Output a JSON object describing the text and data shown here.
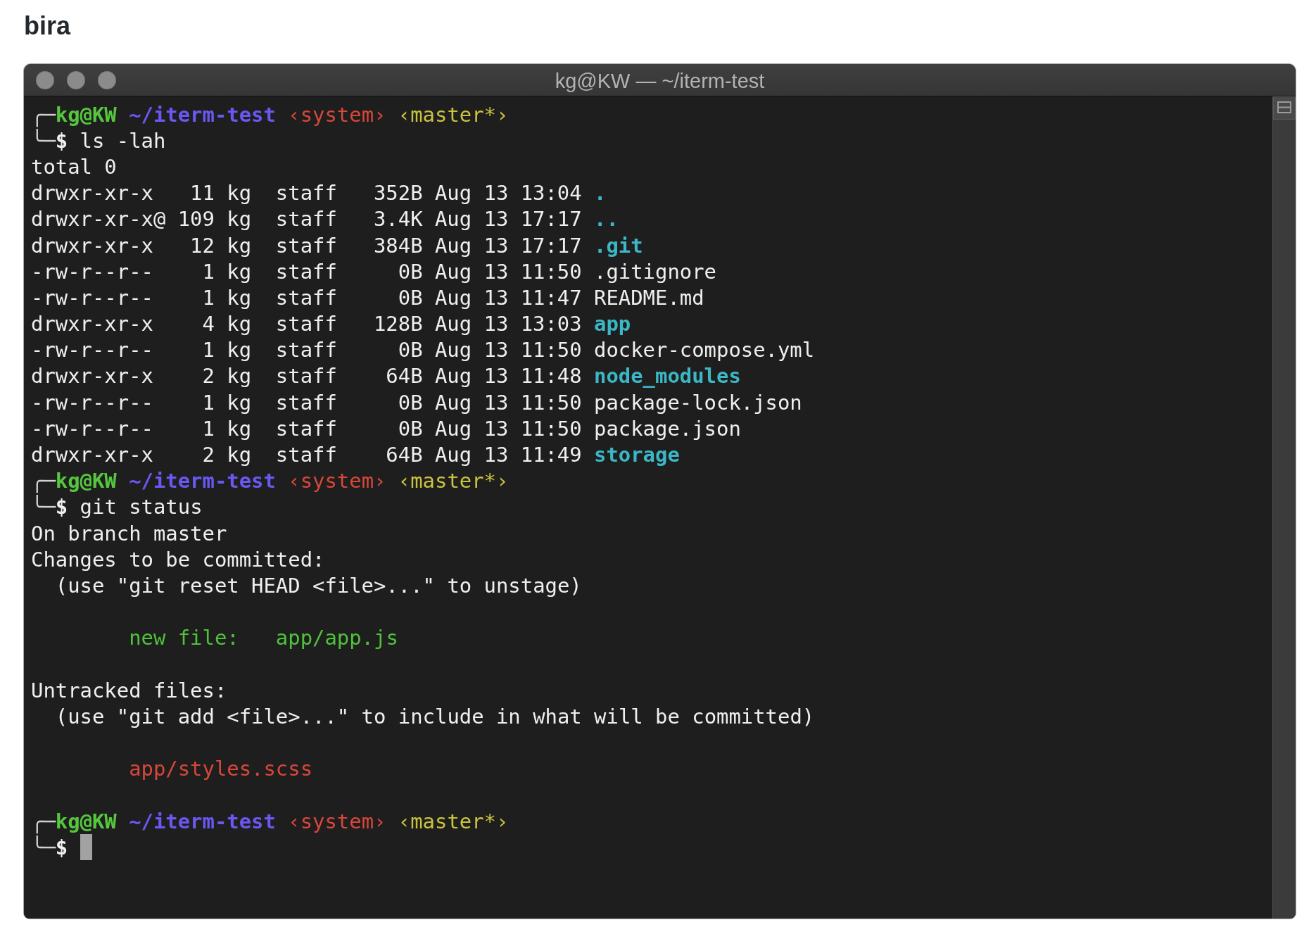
{
  "heading": "bira",
  "window": {
    "title": "kg@KW — ~/iterm-test"
  },
  "terminal": {
    "lines": [
      {
        "kind": "prompt",
        "corner": "╭─",
        "user_host": "kg@KW",
        "directory": "~/iterm-test",
        "ruby": "‹system›",
        "branch": "‹master*›"
      },
      {
        "kind": "command",
        "corner": "╰─",
        "symbol": "$",
        "command": "ls -lah",
        "cursor": false
      },
      {
        "kind": "output",
        "text": "total 0"
      },
      {
        "kind": "listing",
        "permissions": "drwxr-xr-x",
        "links": "11",
        "owner": "kg",
        "group": "staff",
        "size": "352B",
        "modified": "Aug 13 13:04",
        "name": ".",
        "directory": true
      },
      {
        "kind": "listing",
        "permissions": "drwxr-xr-x@",
        "links": "109",
        "owner": "kg",
        "group": "staff",
        "size": "3.4K",
        "modified": "Aug 13 17:17",
        "name": "..",
        "directory": true
      },
      {
        "kind": "listing",
        "permissions": "drwxr-xr-x",
        "links": "12",
        "owner": "kg",
        "group": "staff",
        "size": "384B",
        "modified": "Aug 13 17:17",
        "name": ".git",
        "directory": true
      },
      {
        "kind": "listing",
        "permissions": "-rw-r--r--",
        "links": "1",
        "owner": "kg",
        "group": "staff",
        "size": "0B",
        "modified": "Aug 13 11:50",
        "name": ".gitignore",
        "directory": false
      },
      {
        "kind": "listing",
        "permissions": "-rw-r--r--",
        "links": "1",
        "owner": "kg",
        "group": "staff",
        "size": "0B",
        "modified": "Aug 13 11:47",
        "name": "README.md",
        "directory": false
      },
      {
        "kind": "listing",
        "permissions": "drwxr-xr-x",
        "links": "4",
        "owner": "kg",
        "group": "staff",
        "size": "128B",
        "modified": "Aug 13 13:03",
        "name": "app",
        "directory": true
      },
      {
        "kind": "listing",
        "permissions": "-rw-r--r--",
        "links": "1",
        "owner": "kg",
        "group": "staff",
        "size": "0B",
        "modified": "Aug 13 11:50",
        "name": "docker-compose.yml",
        "directory": false
      },
      {
        "kind": "listing",
        "permissions": "drwxr-xr-x",
        "links": "2",
        "owner": "kg",
        "group": "staff",
        "size": "64B",
        "modified": "Aug 13 11:48",
        "name": "node_modules",
        "directory": true
      },
      {
        "kind": "listing",
        "permissions": "-rw-r--r--",
        "links": "1",
        "owner": "kg",
        "group": "staff",
        "size": "0B",
        "modified": "Aug 13 11:50",
        "name": "package-lock.json",
        "directory": false
      },
      {
        "kind": "listing",
        "permissions": "-rw-r--r--",
        "links": "1",
        "owner": "kg",
        "group": "staff",
        "size": "0B",
        "modified": "Aug 13 11:50",
        "name": "package.json",
        "directory": false
      },
      {
        "kind": "listing",
        "permissions": "drwxr-xr-x",
        "links": "2",
        "owner": "kg",
        "group": "staff",
        "size": "64B",
        "modified": "Aug 13 11:49",
        "name": "storage",
        "directory": true
      },
      {
        "kind": "prompt",
        "corner": "╭─",
        "user_host": "kg@KW",
        "directory": "~/iterm-test",
        "ruby": "‹system›",
        "branch": "‹master*›"
      },
      {
        "kind": "command",
        "corner": "╰─",
        "symbol": "$",
        "command": "git status",
        "cursor": false
      },
      {
        "kind": "output",
        "text": "On branch master"
      },
      {
        "kind": "output",
        "text": "Changes to be committed:"
      },
      {
        "kind": "hint",
        "text": "(use \"git reset HEAD <file>...\" to unstage)"
      },
      {
        "kind": "blank"
      },
      {
        "kind": "staged",
        "text": "new file:   app/app.js"
      },
      {
        "kind": "blank"
      },
      {
        "kind": "output",
        "text": "Untracked files:"
      },
      {
        "kind": "hint",
        "text": "(use \"git add <file>...\" to include in what will be committed)"
      },
      {
        "kind": "blank"
      },
      {
        "kind": "untracked",
        "text": "app/styles.scss"
      },
      {
        "kind": "blank"
      },
      {
        "kind": "prompt",
        "corner": "╭─",
        "user_host": "kg@KW",
        "directory": "~/iterm-test",
        "ruby": "‹system›",
        "branch": "‹master*›"
      },
      {
        "kind": "command",
        "corner": "╰─",
        "symbol": "$",
        "cursor": true
      }
    ]
  }
}
